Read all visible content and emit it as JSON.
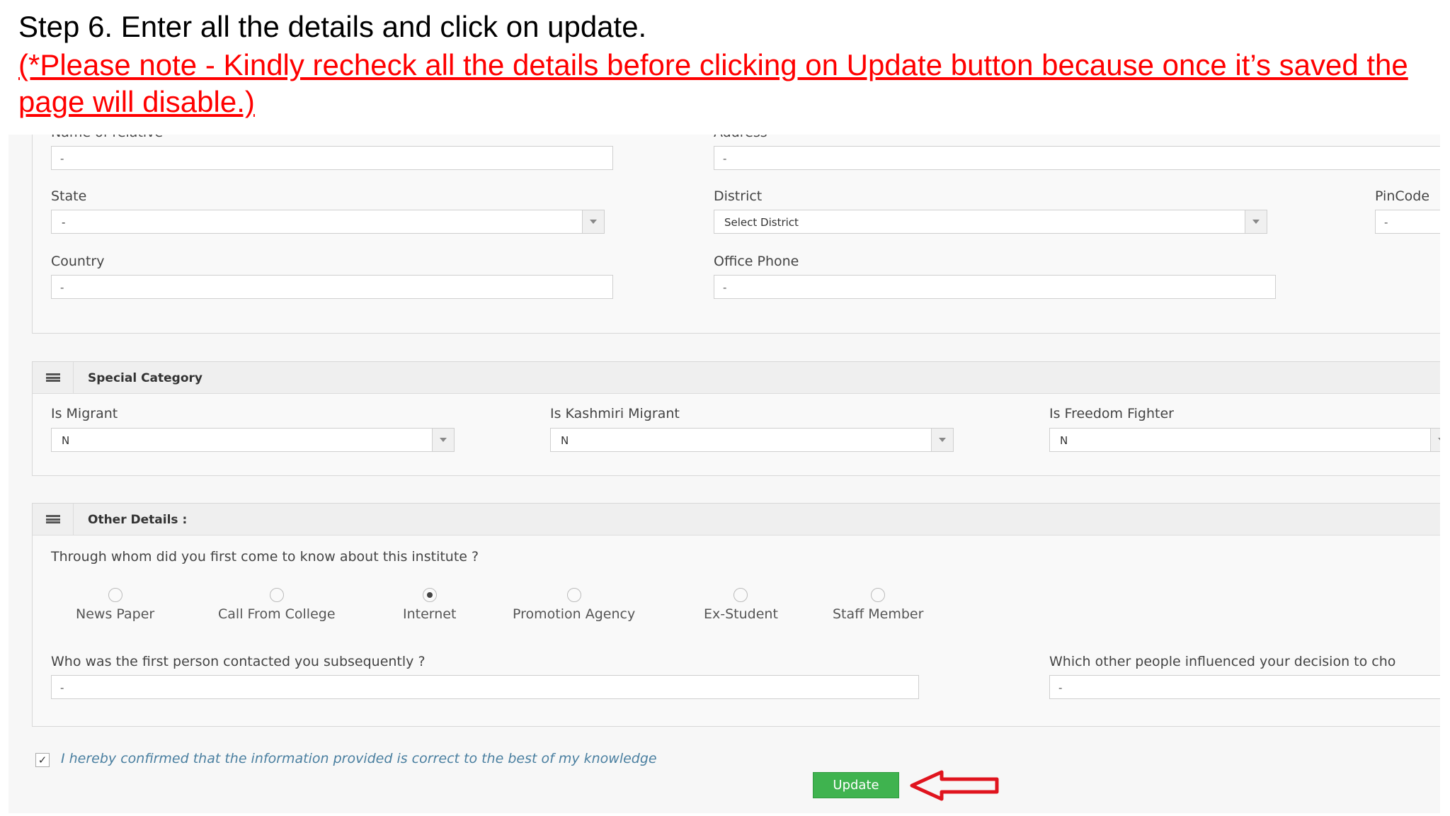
{
  "slide": {
    "title": "Step 6. Enter all the details and click on update.",
    "note": "(*Please note - Kindly recheck all the details before clicking on Update button because once it’s saved the page will disable.)"
  },
  "address_section": {
    "name_of_relative_label": "Name of relative",
    "name_of_relative_value": "-",
    "address_label": "Address",
    "address_value": "-",
    "state_label": "State",
    "state_value": "-",
    "district_label": "District",
    "district_value": "Select District",
    "pincode_label": "PinCode",
    "pincode_value": "-",
    "country_label": "Country",
    "country_value": "-",
    "office_phone_label": "Office Phone",
    "office_phone_value": "-"
  },
  "special_category": {
    "title": "Special Category",
    "is_migrant_label": "Is Migrant",
    "is_migrant_value": "N",
    "is_kashmiri_migrant_label": "Is Kashmiri Migrant",
    "is_kashmiri_migrant_value": "N",
    "is_freedom_fighter_label": "Is Freedom Fighter",
    "is_freedom_fighter_value": "N"
  },
  "other_details": {
    "title": "Other Details :",
    "question": "Through whom did you first come to know about this institute ?",
    "options": [
      {
        "label": "News Paper",
        "selected": false
      },
      {
        "label": "Call From College",
        "selected": false
      },
      {
        "label": "Internet",
        "selected": true
      },
      {
        "label": "Promotion Agency",
        "selected": false
      },
      {
        "label": "Ex-Student",
        "selected": false
      },
      {
        "label": "Staff Member",
        "selected": false
      }
    ],
    "first_person_label": "Who was the first person contacted you subsequently ?",
    "first_person_value": "-",
    "influenced_label": "Which other people influenced your decision to cho",
    "influenced_value": "-"
  },
  "confirm": {
    "checked": true,
    "check_glyph": "✓",
    "text": "I hereby confirmed that the information provided is correct to the best of my knowledge"
  },
  "update_button": {
    "label": "Update"
  },
  "colors": {
    "note": "#ff0000",
    "update_button": "#3fb34f",
    "arrow": "#e0141e"
  }
}
